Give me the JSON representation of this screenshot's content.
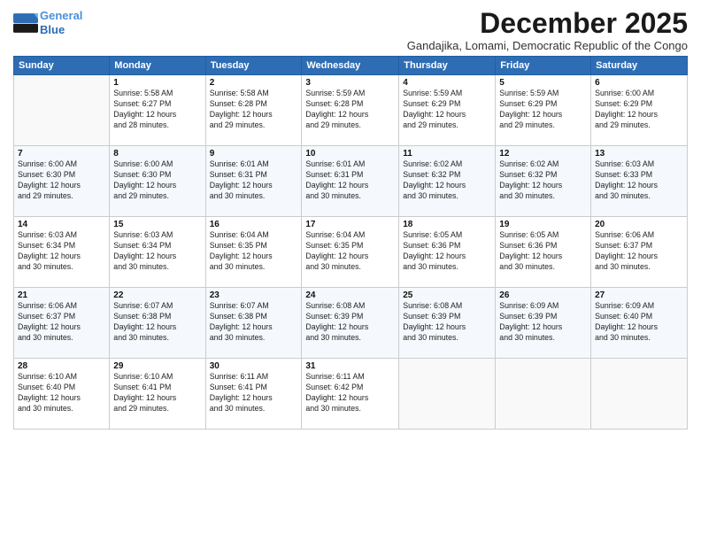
{
  "logo": {
    "line1": "General",
    "line2": "Blue"
  },
  "title": "December 2025",
  "subtitle": "Gandajika, Lomami, Democratic Republic of the Congo",
  "headers": [
    "Sunday",
    "Monday",
    "Tuesday",
    "Wednesday",
    "Thursday",
    "Friday",
    "Saturday"
  ],
  "weeks": [
    [
      {
        "day": "",
        "info": ""
      },
      {
        "day": "1",
        "info": "Sunrise: 5:58 AM\nSunset: 6:27 PM\nDaylight: 12 hours\nand 28 minutes."
      },
      {
        "day": "2",
        "info": "Sunrise: 5:58 AM\nSunset: 6:28 PM\nDaylight: 12 hours\nand 29 minutes."
      },
      {
        "day": "3",
        "info": "Sunrise: 5:59 AM\nSunset: 6:28 PM\nDaylight: 12 hours\nand 29 minutes."
      },
      {
        "day": "4",
        "info": "Sunrise: 5:59 AM\nSunset: 6:29 PM\nDaylight: 12 hours\nand 29 minutes."
      },
      {
        "day": "5",
        "info": "Sunrise: 5:59 AM\nSunset: 6:29 PM\nDaylight: 12 hours\nand 29 minutes."
      },
      {
        "day": "6",
        "info": "Sunrise: 6:00 AM\nSunset: 6:29 PM\nDaylight: 12 hours\nand 29 minutes."
      }
    ],
    [
      {
        "day": "7",
        "info": "Sunrise: 6:00 AM\nSunset: 6:30 PM\nDaylight: 12 hours\nand 29 minutes."
      },
      {
        "day": "8",
        "info": "Sunrise: 6:00 AM\nSunset: 6:30 PM\nDaylight: 12 hours\nand 29 minutes."
      },
      {
        "day": "9",
        "info": "Sunrise: 6:01 AM\nSunset: 6:31 PM\nDaylight: 12 hours\nand 30 minutes."
      },
      {
        "day": "10",
        "info": "Sunrise: 6:01 AM\nSunset: 6:31 PM\nDaylight: 12 hours\nand 30 minutes."
      },
      {
        "day": "11",
        "info": "Sunrise: 6:02 AM\nSunset: 6:32 PM\nDaylight: 12 hours\nand 30 minutes."
      },
      {
        "day": "12",
        "info": "Sunrise: 6:02 AM\nSunset: 6:32 PM\nDaylight: 12 hours\nand 30 minutes."
      },
      {
        "day": "13",
        "info": "Sunrise: 6:03 AM\nSunset: 6:33 PM\nDaylight: 12 hours\nand 30 minutes."
      }
    ],
    [
      {
        "day": "14",
        "info": "Sunrise: 6:03 AM\nSunset: 6:34 PM\nDaylight: 12 hours\nand 30 minutes."
      },
      {
        "day": "15",
        "info": "Sunrise: 6:03 AM\nSunset: 6:34 PM\nDaylight: 12 hours\nand 30 minutes."
      },
      {
        "day": "16",
        "info": "Sunrise: 6:04 AM\nSunset: 6:35 PM\nDaylight: 12 hours\nand 30 minutes."
      },
      {
        "day": "17",
        "info": "Sunrise: 6:04 AM\nSunset: 6:35 PM\nDaylight: 12 hours\nand 30 minutes."
      },
      {
        "day": "18",
        "info": "Sunrise: 6:05 AM\nSunset: 6:36 PM\nDaylight: 12 hours\nand 30 minutes."
      },
      {
        "day": "19",
        "info": "Sunrise: 6:05 AM\nSunset: 6:36 PM\nDaylight: 12 hours\nand 30 minutes."
      },
      {
        "day": "20",
        "info": "Sunrise: 6:06 AM\nSunset: 6:37 PM\nDaylight: 12 hours\nand 30 minutes."
      }
    ],
    [
      {
        "day": "21",
        "info": "Sunrise: 6:06 AM\nSunset: 6:37 PM\nDaylight: 12 hours\nand 30 minutes."
      },
      {
        "day": "22",
        "info": "Sunrise: 6:07 AM\nSunset: 6:38 PM\nDaylight: 12 hours\nand 30 minutes."
      },
      {
        "day": "23",
        "info": "Sunrise: 6:07 AM\nSunset: 6:38 PM\nDaylight: 12 hours\nand 30 minutes."
      },
      {
        "day": "24",
        "info": "Sunrise: 6:08 AM\nSunset: 6:39 PM\nDaylight: 12 hours\nand 30 minutes."
      },
      {
        "day": "25",
        "info": "Sunrise: 6:08 AM\nSunset: 6:39 PM\nDaylight: 12 hours\nand 30 minutes."
      },
      {
        "day": "26",
        "info": "Sunrise: 6:09 AM\nSunset: 6:39 PM\nDaylight: 12 hours\nand 30 minutes."
      },
      {
        "day": "27",
        "info": "Sunrise: 6:09 AM\nSunset: 6:40 PM\nDaylight: 12 hours\nand 30 minutes."
      }
    ],
    [
      {
        "day": "28",
        "info": "Sunrise: 6:10 AM\nSunset: 6:40 PM\nDaylight: 12 hours\nand 30 minutes."
      },
      {
        "day": "29",
        "info": "Sunrise: 6:10 AM\nSunset: 6:41 PM\nDaylight: 12 hours\nand 29 minutes."
      },
      {
        "day": "30",
        "info": "Sunrise: 6:11 AM\nSunset: 6:41 PM\nDaylight: 12 hours\nand 30 minutes."
      },
      {
        "day": "31",
        "info": "Sunrise: 6:11 AM\nSunset: 6:42 PM\nDaylight: 12 hours\nand 30 minutes."
      },
      {
        "day": "",
        "info": ""
      },
      {
        "day": "",
        "info": ""
      },
      {
        "day": "",
        "info": ""
      }
    ]
  ]
}
